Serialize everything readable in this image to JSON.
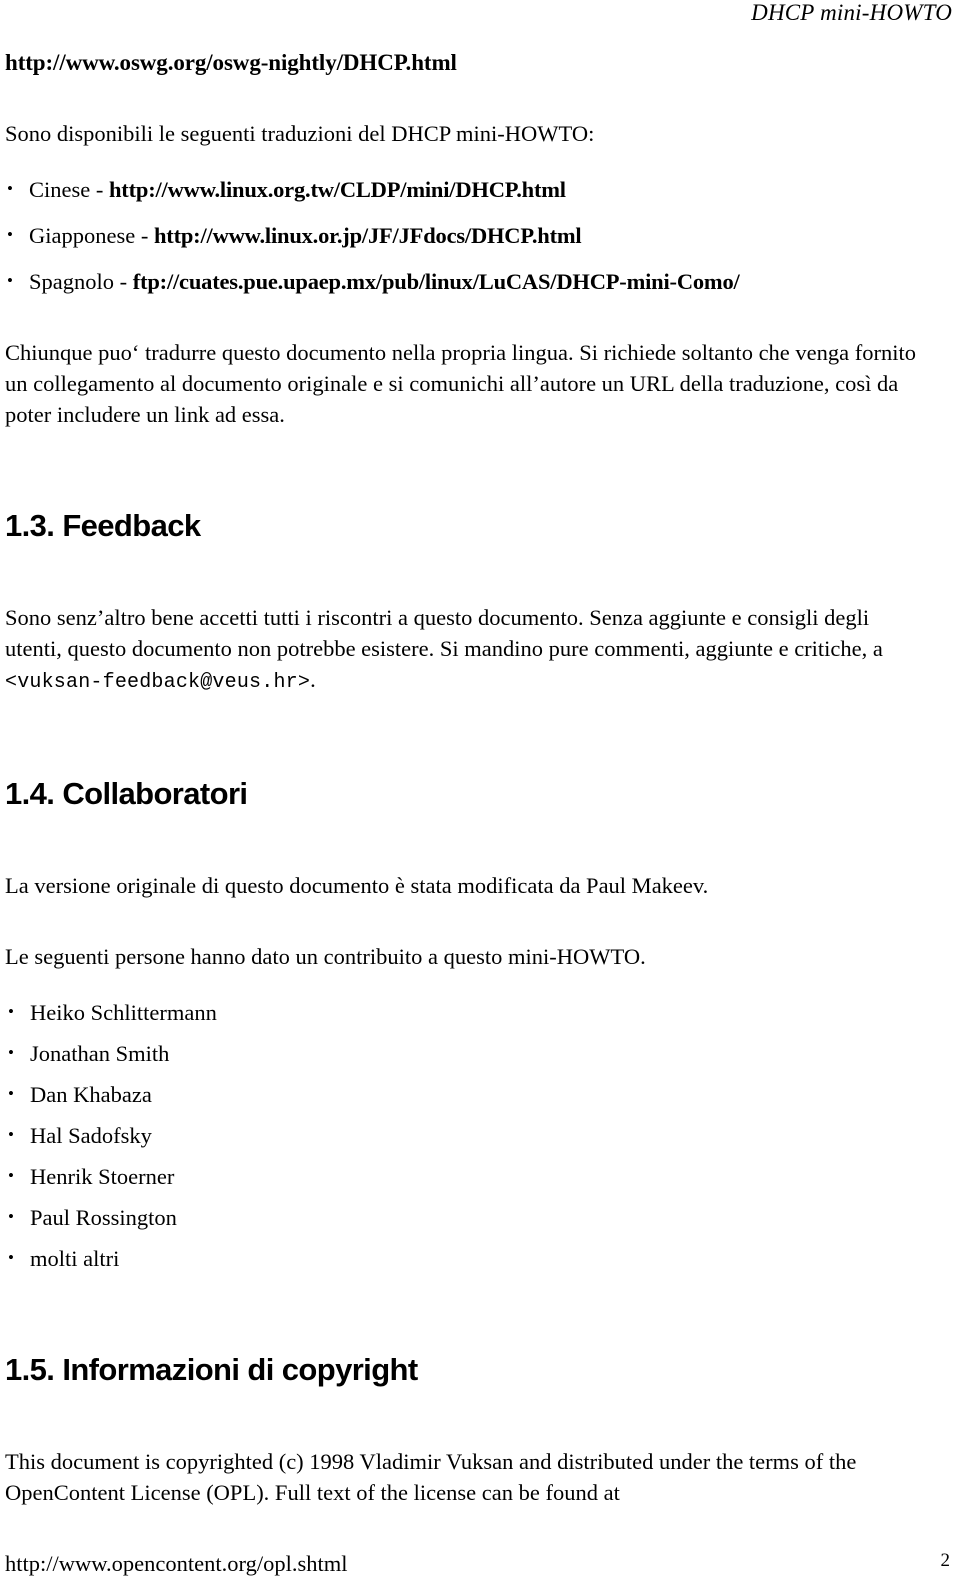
{
  "header": {
    "running_title": "DHCP mini-HOWTO",
    "page_number": "2"
  },
  "lead": {
    "url": "http://www.oswg.org/oswg-nightly/DHCP.html"
  },
  "translations": {
    "intro": "Sono disponibili le seguenti traduzioni del DHCP mini-HOWTO:",
    "bullet_glyph": "•",
    "items": [
      {
        "label": "Cinese - ",
        "url": "http://www.linux.org.tw/CLDP/mini/DHCP.html"
      },
      {
        "label": "Giapponese - ",
        "url": "http://www.linux.or.jp/JF/JFdocs/DHCP.html"
      },
      {
        "label": "Spagnolo - ",
        "url": "ftp://cuates.pue.upaep.mx/pub/linux/LuCAS/DHCP-mini-Como/"
      }
    ],
    "note": "Chiunque puo‘ tradurre questo documento nella propria lingua. Si richiede soltanto che venga fornito un collegamento al documento originale e si comunichi all’autore un URL della traduzione, così da poter includere un link ad essa."
  },
  "feedback": {
    "heading": "1.3. Feedback",
    "paragraph_before_email": "Sono senz’altro bene accetti tutti i riscontri a questo documento. Senza aggiunte e consigli degli utenti, questo documento non potrebbe esistere. Si mandino pure commenti, aggiunte e critiche, a ",
    "email": "<vuksan-feedback@veus.hr>",
    "paragraph_after_email": "."
  },
  "collaborators": {
    "heading": "1.4. Collaboratori",
    "paragraph_1": "La versione originale di questo documento è stata modificata da Paul Makeev.",
    "paragraph_2": "Le seguenti persone hanno dato un contribuito a questo mini-HOWTO.",
    "bullet_glyph": "•",
    "people": [
      "Heiko Schlittermann",
      "Jonathan Smith",
      "Dan Khabaza",
      "Hal Sadofsky",
      "Henrik Stoerner",
      "Paul Rossington",
      "molti altri"
    ]
  },
  "copyright": {
    "heading": "1.5. Informazioni di copyright",
    "paragraph": "This document is copyrighted (c) 1998 Vladimir Vuksan and distributed under the terms of the OpenContent License (OPL). Full text of the license can be found at",
    "url": "http://www.opencontent.org/opl.shtml"
  }
}
